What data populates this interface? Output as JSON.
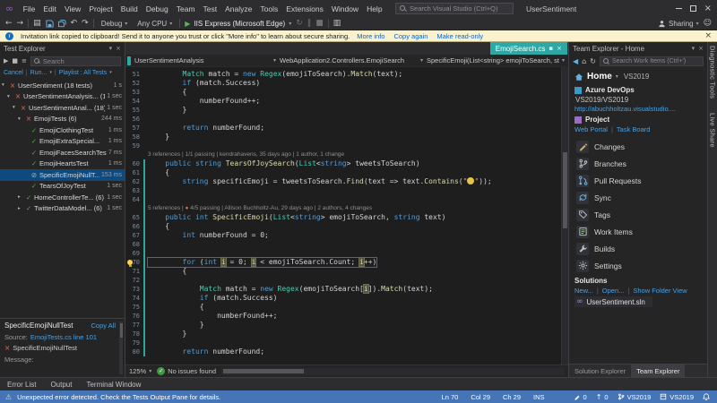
{
  "titlebar": {
    "menus": [
      "File",
      "Edit",
      "View",
      "Project",
      "Build",
      "Debug",
      "Team",
      "Test",
      "Analyze",
      "Tools",
      "Extensions",
      "Window",
      "Help"
    ],
    "search_placeholder": "Search Visual Studio (Ctrl+Q)",
    "solution_name": "UserSentiment"
  },
  "toolbar": {
    "configuration": "Debug",
    "platform": "Any CPU",
    "start_label": "IIS Express (Microsoft Edge)",
    "sharing_label": "Sharing"
  },
  "infobar": {
    "message": "Invitation link copied to clipboard! Send it to anyone you trust or click \"More info\" to learn about secure sharing.",
    "links": [
      "More info",
      "Copy again",
      "Make read-only"
    ]
  },
  "test_explorer": {
    "title": "Test Explorer",
    "search_placeholder": "Search",
    "toolbar_links": [
      "Cancel",
      "Run...",
      "Playlist : All Tests"
    ],
    "tree": [
      {
        "depth": 0,
        "expand": "open",
        "status": "failed",
        "label": "UserSentiment (18 tests)",
        "time": "1 s"
      },
      {
        "depth": 1,
        "expand": "open",
        "status": "failed",
        "label": "UserSentimentAnalysis... (18)",
        "time": "1 sec"
      },
      {
        "depth": 2,
        "expand": "open",
        "status": "failed",
        "label": "UserSentimentAnal... (18)",
        "time": "1 sec"
      },
      {
        "depth": 3,
        "expand": "open",
        "status": "failed",
        "label": "EmojiTests (6)",
        "time": "244 ms"
      },
      {
        "depth": 4,
        "status": "passed",
        "label": "EmojiClothingTest",
        "time": "1 ms"
      },
      {
        "depth": 4,
        "status": "passed",
        "label": "EmojiExtraSpecial...",
        "time": "1 ms"
      },
      {
        "depth": 4,
        "status": "passed",
        "label": "EmojiFacesSearchTest",
        "time": "7 ms"
      },
      {
        "depth": 4,
        "status": "passed",
        "label": "EmojiHeartsTest",
        "time": "1 ms"
      },
      {
        "depth": 4,
        "status": "notrun",
        "label": "SpecificEmojiNullT...",
        "time": "153 ms",
        "selected": true
      },
      {
        "depth": 4,
        "status": "passed",
        "label": "TearsOfJoyTest",
        "time": "1 sec"
      },
      {
        "depth": 3,
        "expand": "closed",
        "status": "passed",
        "label": "HomeControllerTe... (6)",
        "time": "1 sec"
      },
      {
        "depth": 3,
        "expand": "closed",
        "status": "passed",
        "label": "TwitterDataModel... (6)",
        "time": "1 sec"
      }
    ],
    "details": {
      "title": "SpecificEmojiNullTest",
      "copy_all": "Copy All",
      "source_label": "Source:",
      "source_link": "EmojiTests.cs line 101",
      "failed_test": "SpecificEmojiNullTest",
      "message_label": "Message:"
    }
  },
  "editor": {
    "tab": {
      "label": "EmojiSearch.cs"
    },
    "navbar": {
      "project": "UserSentimentAnalysis",
      "type": "WebApplication2.Controllers.EmojiSearch",
      "member": "SpecificEmoji(List<string> emojiToSearch, string text)"
    },
    "zoom": "125%",
    "health": "No issues found",
    "lines": [
      {
        "n": 51,
        "tokens": [
          [
            "p",
            "        "
          ],
          [
            "t",
            "Match"
          ],
          [
            "p",
            " match = "
          ],
          [
            "k",
            "new"
          ],
          [
            "p",
            " "
          ],
          [
            "t",
            "Regex"
          ],
          [
            "p",
            "(emojiToSearch)."
          ],
          [
            "m",
            "Match"
          ],
          [
            "p",
            "(text);"
          ]
        ]
      },
      {
        "n": 52,
        "tokens": [
          [
            "p",
            "        "
          ],
          [
            "k",
            "if"
          ],
          [
            "p",
            " (match.Success)"
          ]
        ]
      },
      {
        "n": 53,
        "tokens": [
          [
            "p",
            "        {"
          ]
        ]
      },
      {
        "n": 54,
        "tokens": [
          [
            "p",
            "            numberFound++;"
          ]
        ]
      },
      {
        "n": 55,
        "tokens": [
          [
            "p",
            "        }"
          ]
        ]
      },
      {
        "n": 56,
        "tokens": []
      },
      {
        "n": 57,
        "tokens": [
          [
            "p",
            "        "
          ],
          [
            "k",
            "return"
          ],
          [
            "p",
            " numberFound;"
          ]
        ]
      },
      {
        "n": 58,
        "tokens": [
          [
            "p",
            "    }"
          ]
        ]
      },
      {
        "n": 59,
        "tokens": []
      },
      {
        "lens": true,
        "tokens": [
          [
            "g",
            "3 references"
          ],
          [
            "g",
            " | "
          ],
          [
            "g",
            "1/1 passing"
          ],
          [
            "g",
            " | "
          ],
          [
            "g",
            "kendrahavens, 35 days ago"
          ],
          [
            "g",
            " | "
          ],
          [
            "g",
            "1 author, 1 change"
          ]
        ]
      },
      {
        "n": 60,
        "chg": true,
        "tokens": [
          [
            "p",
            "    "
          ],
          [
            "k",
            "public"
          ],
          [
            "p",
            " "
          ],
          [
            "k",
            "string"
          ],
          [
            "p",
            " "
          ],
          [
            "m",
            "TearsOfJoySearch"
          ],
          [
            "p",
            "("
          ],
          [
            "t",
            "List"
          ],
          [
            "p",
            "<"
          ],
          [
            "k",
            "string"
          ],
          [
            "p",
            "> tweetsToSearch)"
          ]
        ]
      },
      {
        "n": 61,
        "chg": true,
        "tokens": [
          [
            "p",
            "    {"
          ]
        ]
      },
      {
        "n": 62,
        "chg": true,
        "tokens": [
          [
            "p",
            "        "
          ],
          [
            "k",
            "string"
          ],
          [
            "p",
            " specificEmoji = tweetsToSearch."
          ],
          [
            "m",
            "Find"
          ],
          [
            "p",
            "(text => text."
          ],
          [
            "m",
            "Contains"
          ],
          [
            "p",
            "("
          ],
          [
            "s",
            "\""
          ],
          [
            "e",
            "😂"
          ],
          [
            "s",
            "\""
          ],
          [
            "p",
            "));"
          ]
        ]
      },
      {
        "n": 63,
        "chg": true,
        "tokens": []
      },
      {
        "n": 64,
        "chg": true,
        "tokens": []
      },
      {
        "lens": true,
        "chg": true,
        "tokens": [
          [
            "g",
            "5 references"
          ],
          [
            "g",
            " | "
          ],
          [
            "rd",
            "● "
          ],
          [
            "g",
            "4/5 passing"
          ],
          [
            "g",
            " | "
          ],
          [
            "g",
            "Allison Buchholtz-Au, 29 days ago"
          ],
          [
            "g",
            " | "
          ],
          [
            "g",
            "2 authors, 4 changes"
          ]
        ]
      },
      {
        "n": 65,
        "chg": true,
        "tokens": [
          [
            "p",
            "    "
          ],
          [
            "k",
            "public"
          ],
          [
            "p",
            " "
          ],
          [
            "k",
            "int"
          ],
          [
            "p",
            " "
          ],
          [
            "m",
            "SpecificEmoji"
          ],
          [
            "p",
            "("
          ],
          [
            "t",
            "List"
          ],
          [
            "p",
            "<"
          ],
          [
            "k",
            "string"
          ],
          [
            "p",
            "> emojiToSearch, "
          ],
          [
            "k",
            "string"
          ],
          [
            "p",
            " text)"
          ]
        ]
      },
      {
        "n": 66,
        "chg": true,
        "tokens": [
          [
            "p",
            "    {"
          ]
        ]
      },
      {
        "n": 67,
        "chg": true,
        "tokens": [
          [
            "p",
            "        "
          ],
          [
            "k",
            "int"
          ],
          [
            "p",
            " numberFound = 0;"
          ]
        ]
      },
      {
        "n": 68,
        "chg": true,
        "tokens": []
      },
      {
        "n": 69,
        "chg": true,
        "tokens": []
      },
      {
        "n": 70,
        "chg": true,
        "cur": true,
        "bulb": true,
        "tokens": [
          [
            "p",
            "        "
          ],
          [
            "k",
            "for"
          ],
          [
            "p",
            " ("
          ],
          [
            "k",
            "int"
          ],
          [
            "p",
            " "
          ],
          [
            "hi",
            "i"
          ],
          [
            "p",
            " = 0; "
          ],
          [
            "hi",
            "i"
          ],
          [
            "p",
            " < emojiToSearch.Count; "
          ],
          [
            "hi",
            "i"
          ],
          [
            "p",
            "++)"
          ]
        ]
      },
      {
        "n": 71,
        "chg": true,
        "tokens": [
          [
            "p",
            "        {"
          ]
        ]
      },
      {
        "n": 72,
        "chg": true,
        "tokens": []
      },
      {
        "n": 73,
        "chg": true,
        "tokens": [
          [
            "p",
            "            "
          ],
          [
            "t",
            "Match"
          ],
          [
            "p",
            " match = "
          ],
          [
            "k",
            "new"
          ],
          [
            "p",
            " "
          ],
          [
            "t",
            "Regex"
          ],
          [
            "p",
            "(emojiToSearch["
          ],
          [
            "hi",
            "i"
          ],
          [
            "p",
            "])."
          ],
          [
            "m",
            "Match"
          ],
          [
            "p",
            "(text);"
          ]
        ]
      },
      {
        "n": 74,
        "chg": true,
        "tokens": [
          [
            "p",
            "            "
          ],
          [
            "k",
            "if"
          ],
          [
            "p",
            " (match.Success)"
          ]
        ]
      },
      {
        "n": 75,
        "chg": true,
        "tokens": [
          [
            "p",
            "            {"
          ]
        ]
      },
      {
        "n": 76,
        "chg": true,
        "tokens": [
          [
            "p",
            "                numberFound++;"
          ]
        ]
      },
      {
        "n": 77,
        "chg": true,
        "tokens": [
          [
            "p",
            "            }"
          ]
        ]
      },
      {
        "n": 78,
        "chg": true,
        "tokens": [
          [
            "p",
            "        }"
          ]
        ]
      },
      {
        "n": 79,
        "chg": true,
        "tokens": []
      },
      {
        "n": 80,
        "chg": true,
        "tokens": [
          [
            "p",
            "        "
          ],
          [
            "k",
            "return"
          ],
          [
            "p",
            " numberFound;"
          ]
        ]
      }
    ]
  },
  "team_explorer": {
    "title": "Team Explorer - Home",
    "search_placeholder": "Search Work Items (Ctrl+')",
    "page": "Home",
    "context": "VS2019",
    "devops": {
      "title": "Azure DevOps",
      "account": "VS2019/VS2019",
      "url": "http://abuchholtzau.visualstudio...."
    },
    "project": {
      "title": "Project",
      "links": [
        "Web Portal",
        "Task Board"
      ]
    },
    "nav_items": [
      {
        "label": "Changes",
        "icon": "changes-icon"
      },
      {
        "label": "Branches",
        "icon": "branches-icon"
      },
      {
        "label": "Pull Requests",
        "icon": "pull-requests-icon"
      },
      {
        "label": "Sync",
        "icon": "sync-icon"
      },
      {
        "label": "Tags",
        "icon": "tags-icon"
      },
      {
        "label": "Work Items",
        "icon": "work-items-icon"
      },
      {
        "label": "Builds",
        "icon": "builds-icon"
      },
      {
        "label": "Settings",
        "icon": "settings-icon"
      }
    ],
    "solutions": {
      "title": "Solutions",
      "links": [
        "New...",
        "Open...",
        "Show Folder View"
      ],
      "items": [
        "UserSentiment.sln"
      ]
    },
    "bottom_tabs": [
      {
        "label": "Solution Explorer",
        "active": false
      },
      {
        "label": "Team Explorer",
        "active": true
      }
    ]
  },
  "right_strip": {
    "tabs": [
      "Diagnostic Tools",
      "Live Share"
    ]
  },
  "bottom_panel": {
    "tabs": [
      "Error List",
      "Output",
      "Terminal Window"
    ]
  },
  "status_bar": {
    "message": "Unexpected error detected. Check the Tests Output Pane for details.",
    "line": "Ln 70",
    "column": "Col 29",
    "character": "Ch 29",
    "mode": "INS",
    "edits": "0",
    "outgoing": "0",
    "branch": "VS2019",
    "repo": "VS2019"
  }
}
